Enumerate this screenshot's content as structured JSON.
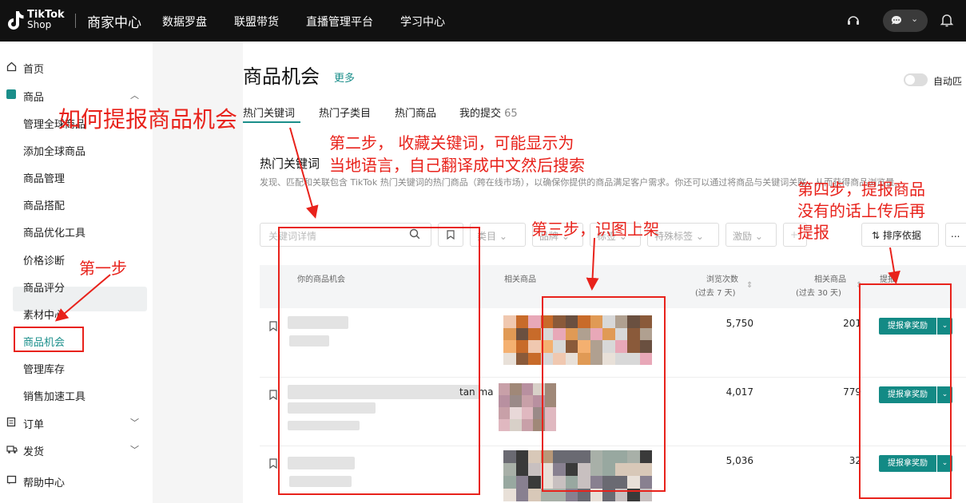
{
  "header": {
    "logo_line1": "TikTok",
    "logo_line2": "Shop",
    "title": "商家中心",
    "nav": [
      "数据罗盘",
      "联盟带货",
      "直播管理平台",
      "学习中心"
    ]
  },
  "sidebar": {
    "home": "首页",
    "products": "商品",
    "items": [
      "管理全球商品",
      "添加全球商品",
      "商品管理",
      "商品搭配",
      "商品优化工具",
      "价格诊断",
      "商品评分",
      "素材中心",
      "商品机会",
      "管理库存",
      "销售加速工具"
    ],
    "orders": "订单",
    "shipping": "发货",
    "help": "帮助中心"
  },
  "page": {
    "title": "商品机会",
    "more": "更多",
    "auto_label": "自动匹",
    "tabs": [
      "热门关键词",
      "热门子类目",
      "热门商品",
      "我的提交"
    ],
    "submission_count": "65",
    "section_title": "热门关键词",
    "section_desc": "发现、匹配和关联包含 TikTok 热门关键词的热门商品（跨在线市场），以确保你提供的商品满足客户需求。你还可以通过将商品与关键词关联，从而获得商品浏览量。"
  },
  "filters": {
    "search_placeholder": "关键词详情",
    "category": "类目",
    "brand": "品牌",
    "tag": "标签",
    "special_tag": "特殊标签",
    "incentive": "激励",
    "sort": "排序依据",
    "more": "..."
  },
  "table": {
    "col_opportunity": "你的商品机会",
    "col_related": "相关商品",
    "col_views": "浏览次数",
    "col_views_sub": "(过去 7 天)",
    "col_related_count": "相关商品",
    "col_related_count_sub": "(过去 30 天)",
    "col_submit": "提报",
    "submit_label": "提报拿奖励",
    "rows": [
      {
        "views": "5,750",
        "related": "201",
        "fragment": ""
      },
      {
        "views": "4,017",
        "related": "779",
        "fragment": "tan ma"
      },
      {
        "views": "5,036",
        "related": "32",
        "fragment": ""
      }
    ]
  },
  "annotations": {
    "main_title": "如何提报商品机会",
    "step1": "第一步",
    "step2_line1": "第二步， 收藏关键词，可能显示为",
    "step2_line2": "当地语言，自己翻译成中文然后搜索",
    "step3": "第三步，识图上架",
    "step4_line1": "第四步，提报商品",
    "step4_line2": "没有的话上传后再",
    "step4_line3": "提报"
  },
  "colors": {
    "accent": "#1a8e8a",
    "annotation_red": "#e8221b",
    "topbar": "#111111"
  }
}
